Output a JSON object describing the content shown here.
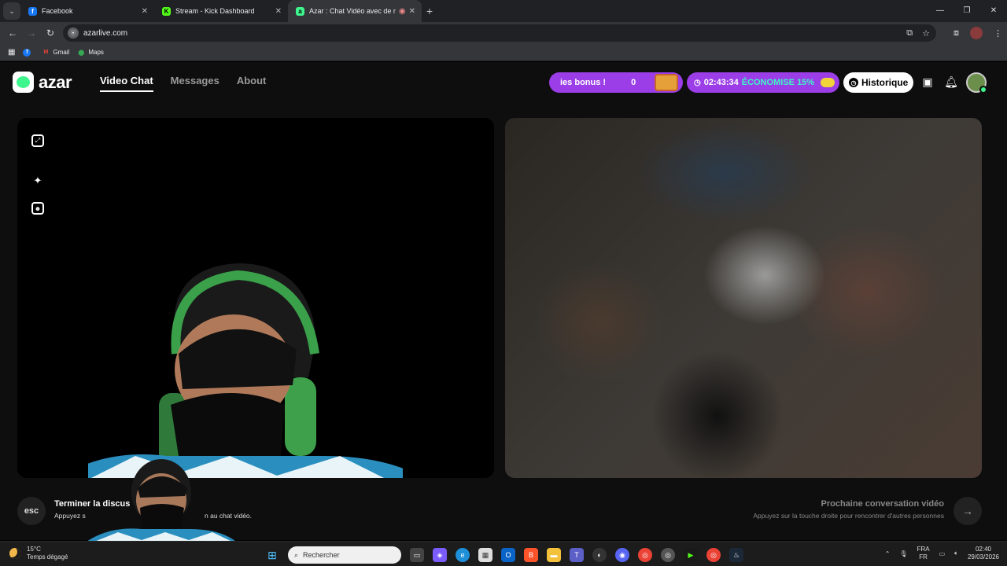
{
  "browser": {
    "tabs": [
      {
        "title": "Facebook",
        "favicon": "facebook-icon",
        "color": "#1877f2",
        "glyph": "f",
        "active": false
      },
      {
        "title": "Stream - Kick Dashboard",
        "favicon": "kick-icon",
        "color": "#53fc18",
        "glyph": "K",
        "active": false
      },
      {
        "title": "Azar : Chat Vidéo avec de n",
        "favicon": "azar-icon",
        "color": "#3ff58d",
        "glyph": "a",
        "active": true
      }
    ],
    "url": "azarlive.com",
    "bookmarks": [
      {
        "label": "",
        "icon": "facebook-icon"
      },
      {
        "label": "Gmail",
        "icon": "gmail-icon"
      },
      {
        "label": "Maps",
        "icon": "maps-icon"
      }
    ]
  },
  "app": {
    "logo_text": "azar",
    "nav": [
      {
        "label": "Video Chat",
        "active": true
      },
      {
        "label": "Messages",
        "active": false
      },
      {
        "label": "About",
        "active": false
      }
    ],
    "bonus_text": "ies bonus !",
    "bonus_count": "0",
    "timer": "02:43:34",
    "save_text": "ÉCONOMISE 15%",
    "history_label": "Historique",
    "end": {
      "key": "esc",
      "title": "Terminer la discus",
      "subtitle_start": "Appuyez s",
      "subtitle_end": "n au chat vidéo."
    },
    "next": {
      "title": "Prochaine conversation vidéo",
      "subtitle": "Appuyez sur la touche droite pour rencontrer d'autres personnes"
    }
  },
  "taskbar": {
    "temperature": "15°C",
    "weather": "Temps dégagé",
    "search_placeholder": "Rechercher",
    "lang_top": "FRA",
    "lang_bottom": "FR",
    "time": "02:40",
    "date": "29/03/2026"
  },
  "colors": {
    "accent_green": "#3ff58d",
    "accent_purple": "#9b3ee8"
  }
}
